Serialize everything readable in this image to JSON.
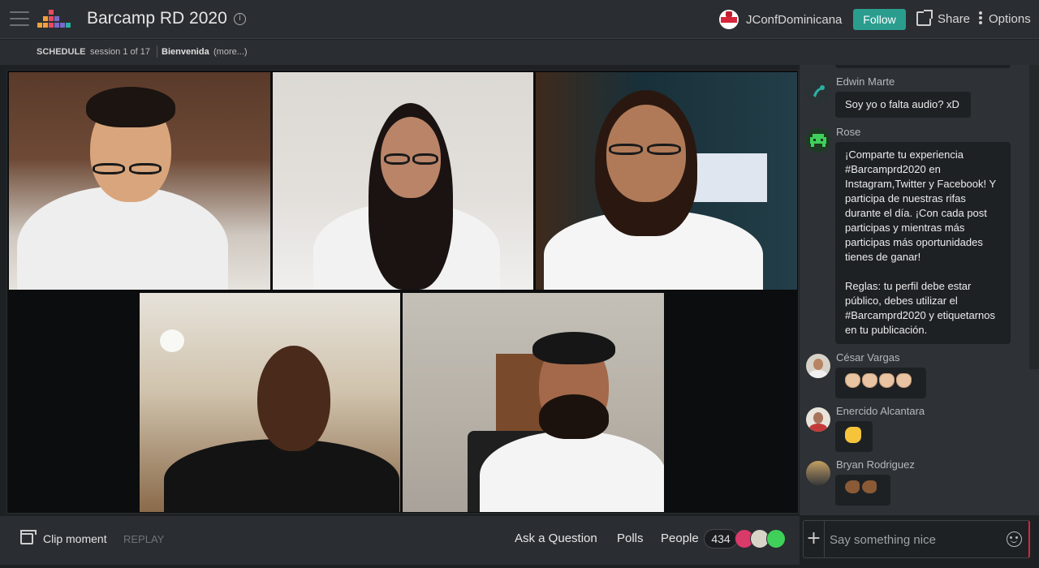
{
  "header": {
    "title": "Barcamp RD 2020",
    "org_name": "JConfDominicana",
    "follow_label": "Follow",
    "share_label": "Share",
    "options_label": "Options",
    "logo_colors": [
      "#f2a03d",
      "#e74c5a",
      "#7b68c8",
      "#2ab0a0"
    ]
  },
  "schedule": {
    "label": "SCHEDULE",
    "session": "session 1 of 17",
    "title": "Bienvenida",
    "more": "(more...)"
  },
  "chat": {
    "messages": [
      {
        "user": "Edwin Marte",
        "text": "Soy yo o falta audio? xD",
        "avatar_icon": "teal-swirl-icon"
      },
      {
        "user": "Rose",
        "text": "¡Comparte tu experiencia #Barcamprd2020 en Instagram,Twitter y Facebook! Y participa de nuestras rifas durante el día. ¡Con cada post participas y mientras más participas más oportunidades tienes de ganar!",
        "text2": "Reglas: tu perfil debe estar público, debes utilizar el #Barcamprd2020 y etiquetarnos en tu publicación.",
        "avatar_icon": "green-invader-icon"
      },
      {
        "user": "César Vargas",
        "emoji": "clapping-hands",
        "avatar_icon": "photo-avatar"
      },
      {
        "user": "Enercido Alcantara",
        "emoji": "thumbs-up",
        "avatar_icon": "photo-avatar"
      },
      {
        "user": "Bryan Rodriguez",
        "emoji": "flexed-biceps",
        "avatar_icon": "photo-avatar"
      }
    ],
    "composer_placeholder": "Say something nice"
  },
  "bottombar": {
    "clip_label": "Clip moment",
    "replay_label": "REPLAY",
    "ask_label": "Ask a Question",
    "polls_label": "Polls",
    "people_label": "People",
    "people_count": "434"
  },
  "colors": {
    "accent": "#2a9d8f",
    "background": "#1e2124",
    "panel": "#2a2d31"
  }
}
